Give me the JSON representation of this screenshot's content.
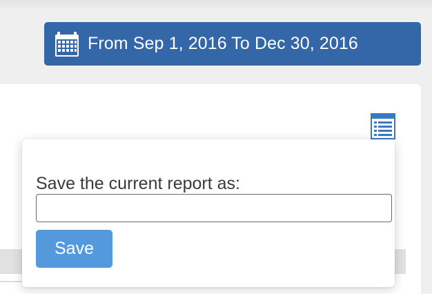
{
  "date_range": {
    "label": "From Sep 1, 2016 To Dec 30, 2016",
    "icon": "calendar-icon",
    "background_color": "#3367a8"
  },
  "report_view": {
    "icon": "list-view-icon",
    "icon_color": "#3a78c2"
  },
  "save_dialog": {
    "label": "Save the current report as:",
    "input_value": "",
    "input_placeholder": "",
    "save_button_label": "Save",
    "save_button_color": "#5599dd"
  }
}
